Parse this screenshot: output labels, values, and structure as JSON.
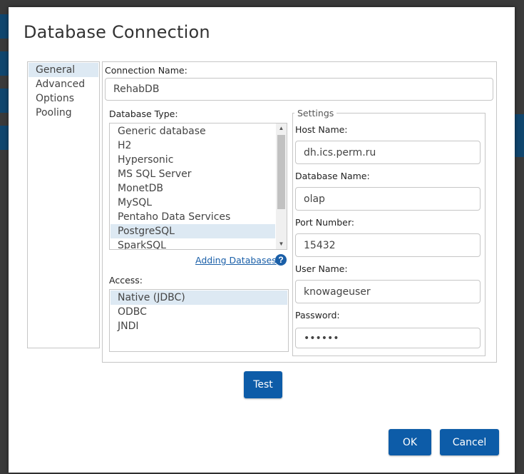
{
  "dialog": {
    "title": "Database Connection"
  },
  "nav": {
    "items": [
      {
        "label": "General",
        "selected": true
      },
      {
        "label": "Advanced",
        "selected": false
      },
      {
        "label": "Options",
        "selected": false
      },
      {
        "label": "Pooling",
        "selected": false
      }
    ]
  },
  "general": {
    "connection_name_label": "Connection Name:",
    "connection_name_value": "RehabDB",
    "database_type_label": "Database Type:",
    "database_types": [
      "Generic database",
      "H2",
      "Hypersonic",
      "MS SQL Server",
      "MonetDB",
      "MySQL",
      "Pentaho Data Services",
      "PostgreSQL",
      "SparkSQL"
    ],
    "database_type_selected": "PostgreSQL",
    "adding_databases_link": "Adding Databases",
    "access_label": "Access:",
    "access_options": [
      "Native (JDBC)",
      "ODBC",
      "JNDI"
    ],
    "access_selected": "Native (JDBC)"
  },
  "settings": {
    "legend": "Settings",
    "host_name_label": "Host Name:",
    "host_name_value": "dh.ics.perm.ru",
    "database_name_label": "Database Name:",
    "database_name_value": "olap",
    "port_number_label": "Port Number:",
    "port_number_value": "15432",
    "user_name_label": "User Name:",
    "user_name_value": "knowageuser",
    "password_label": "Password:",
    "password_value": "••••••"
  },
  "buttons": {
    "test": "Test",
    "ok": "OK",
    "cancel": "Cancel"
  },
  "colors": {
    "accent": "#0d5ca8",
    "selection": "#dde9f3",
    "link": "#1a5fa8"
  }
}
